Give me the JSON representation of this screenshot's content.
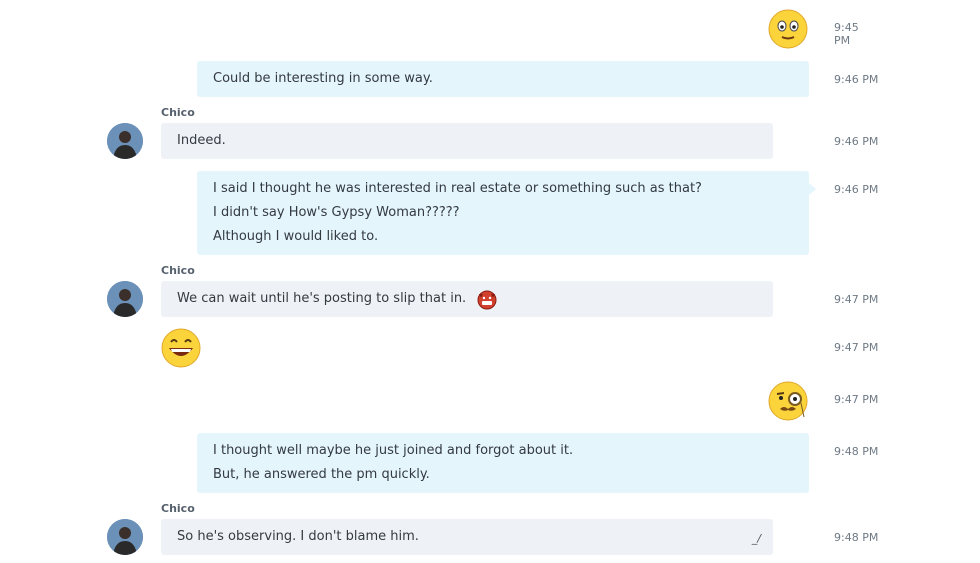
{
  "messages": [
    {
      "time": "9:45 PM"
    },
    {
      "time": "9:46 PM",
      "lines": [
        "Could be interesting in some way."
      ]
    },
    {
      "sender": "Chico",
      "time": "9:46 PM",
      "lines": [
        "Indeed."
      ]
    },
    {
      "time": "9:46 PM",
      "lines": [
        "I said I thought he was interested in real estate or something such as that?",
        "I didn't say How's Gypsy Woman?????",
        "Although I would liked to."
      ]
    },
    {
      "sender": "Chico",
      "time": "9:47 PM",
      "lines": [
        "We can wait until he's posting to slip that in."
      ]
    },
    {
      "time": "9:47 PM"
    },
    {
      "time": "9:47 PM"
    },
    {
      "time": "9:48 PM",
      "lines": [
        "I thought well maybe he just joined and forgot about it.",
        "But, he answered the pm quickly."
      ]
    },
    {
      "sender": "Chico",
      "time": "9:48 PM",
      "lines": [
        "So he's observing.  I don't blame him."
      ]
    }
  ],
  "icons": {
    "smile": "smile-emoji",
    "devil": "devil-emoji",
    "laugh": "laugh-emoji",
    "monocle": "monocle-emoji",
    "edit": "edit-pencil-icon"
  },
  "colors": {
    "outgoing_bubble": "#e5f5fc",
    "incoming_bubble": "#eef2f7",
    "timestamp": "#6f7a85"
  }
}
